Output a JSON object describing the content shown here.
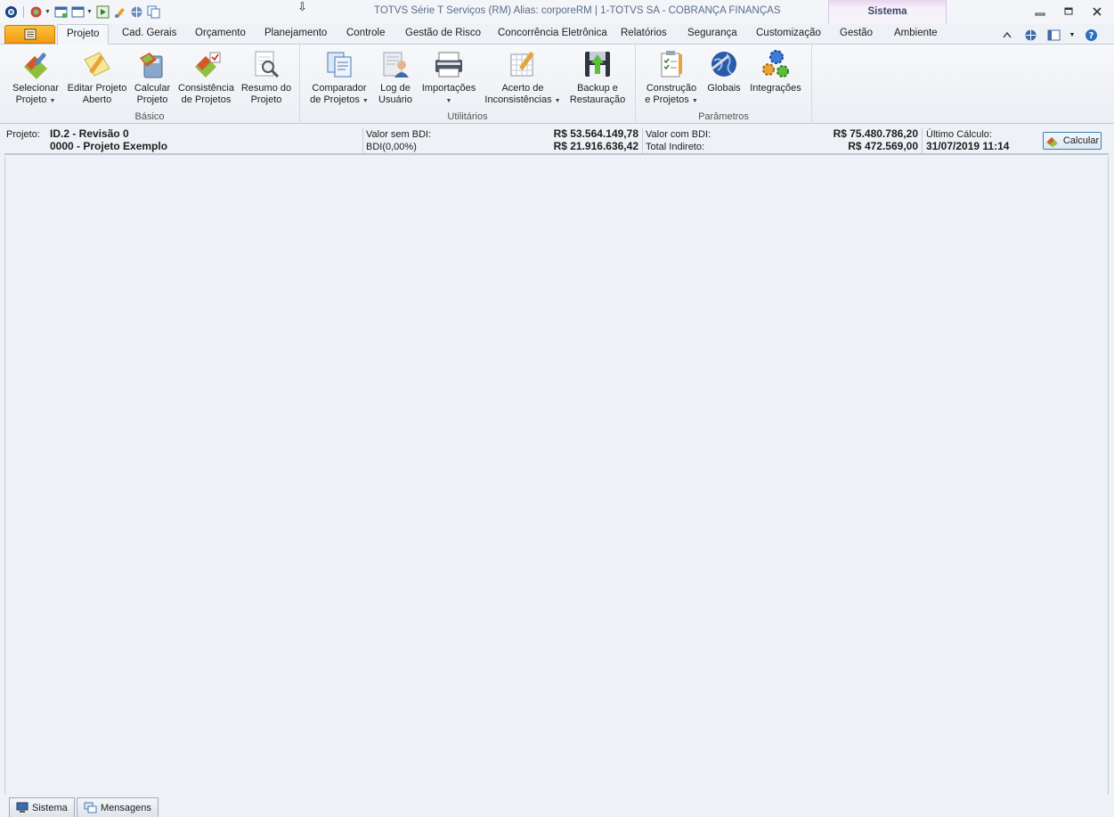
{
  "window": {
    "title": "TOTVS Série T Serviços (RM) Alias: corporeRM | 1-TOTVS SA - COBRANÇA FINANÇAS",
    "context_tab": "Sistema"
  },
  "tabs": [
    {
      "label": "Projeto",
      "active": true
    },
    {
      "label": "Cad. Gerais"
    },
    {
      "label": "Orçamento"
    },
    {
      "label": "Planejamento"
    },
    {
      "label": "Controle"
    },
    {
      "label": "Gestão de Risco"
    },
    {
      "label": "Concorrência Eletrônica"
    },
    {
      "label": "Relatórios"
    },
    {
      "label": "Segurança"
    },
    {
      "label": "Customização"
    },
    {
      "label": "Gestão"
    },
    {
      "label": "Ambiente"
    }
  ],
  "ribbon": {
    "basico": {
      "label": "Básico",
      "buttons": [
        {
          "line1": "Selecionar",
          "line2": "Projeto",
          "icon": "paint-brush-icon"
        },
        {
          "line1": "Editar Projeto",
          "line2": "Aberto",
          "icon": "note-pencil-icon"
        },
        {
          "line1": "Calcular",
          "line2": "Projeto",
          "icon": "calculator-icon"
        },
        {
          "line1": "Consistência",
          "line2": "de Projetos",
          "icon": "checklist-icon"
        },
        {
          "line1": "Resumo do",
          "line2": "Projeto",
          "icon": "magnifier-icon"
        }
      ]
    },
    "utilitarios": {
      "label": "Utilitários",
      "buttons": [
        {
          "line1": "Comparador",
          "line2": "de Projetos",
          "icon": "documents-icon"
        },
        {
          "line1": "Log de",
          "line2": "Usuário",
          "icon": "user-log-icon"
        },
        {
          "line1": "Importações",
          "line2": "",
          "icon": "printer-icon"
        },
        {
          "line1": "Acerto de",
          "line2": "Inconsistências",
          "icon": "grid-pencil-icon"
        },
        {
          "line1": "Backup e",
          "line2": "Restauração",
          "icon": "floppy-icon"
        }
      ]
    },
    "parametros": {
      "label": "Parâmetros",
      "buttons": [
        {
          "line1": "Construção",
          "line2": "e Projetos",
          "icon": "clipboard-icon"
        },
        {
          "line1": "Globais",
          "line2": "",
          "icon": "globe-icon"
        },
        {
          "line1": "Integrações",
          "line2": "",
          "icon": "gears-icon"
        }
      ]
    }
  },
  "info": {
    "projeto_label": "Projeto:",
    "projeto_line1": "ID.2 - Revisão 0",
    "projeto_line2": "0000 - Projeto Exemplo",
    "valor_sem_bdi_label": "Valor sem BDI:",
    "valor_sem_bdi": "R$ 53.564.149,78",
    "bdi_label": "BDI(0,00%)",
    "bdi_value": "R$ 21.916.636,42",
    "valor_com_bdi_label": "Valor com BDI:",
    "valor_com_bdi": "R$ 75.480.786,20",
    "total_indireto_label": "Total Indireto:",
    "total_indireto": "R$ 472.569,00",
    "ultimo_calculo_label": "Último Cálculo:",
    "ultimo_calculo": "31/07/2019 11:14",
    "calcular_label": "Calcular"
  },
  "bottom_tabs": [
    {
      "label": "Sistema",
      "icon": "monitor-icon"
    },
    {
      "label": "Mensagens",
      "icon": "messages-icon"
    }
  ]
}
